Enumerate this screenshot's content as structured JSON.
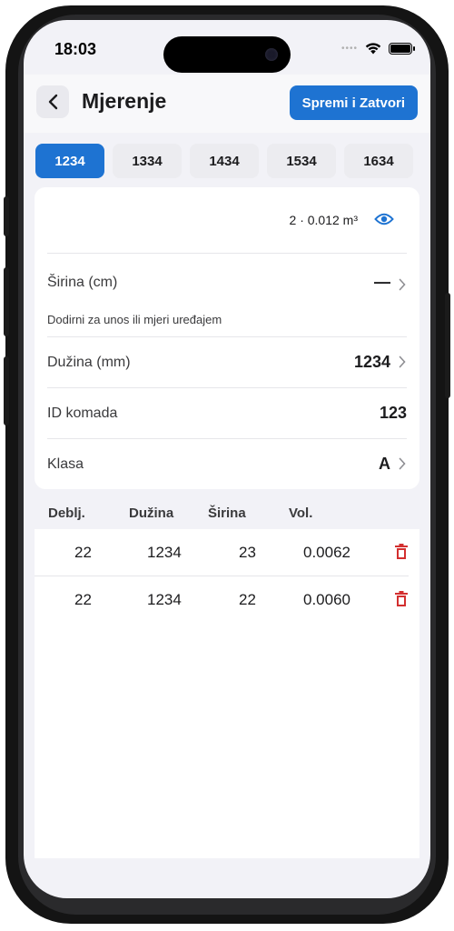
{
  "status_bar": {
    "time": "18:03",
    "dots": "••••"
  },
  "header": {
    "title": "Mjerenje",
    "save_label": "Spremi i Zatvori"
  },
  "tabs": [
    {
      "label": "1234",
      "active": true
    },
    {
      "label": "1334",
      "active": false
    },
    {
      "label": "1434",
      "active": false
    },
    {
      "label": "1534",
      "active": false
    },
    {
      "label": "1634",
      "active": false
    }
  ],
  "summary": {
    "volume_text": "2 · 0.012 m³"
  },
  "form": {
    "width": {
      "label": "Širina (cm)",
      "value": "—",
      "hint": "Dodirni za unos ili mjeri uređajem"
    },
    "length": {
      "label": "Dužina (mm)",
      "value": "1234"
    },
    "piece_id": {
      "label": "ID komada",
      "value": "123"
    },
    "grade": {
      "label": "Klasa",
      "value": "A"
    }
  },
  "table": {
    "headers": {
      "thickness": "Deblj.",
      "length": "Dužina",
      "width": "Širina",
      "volume": "Vol."
    },
    "rows": [
      {
        "thickness": "22",
        "length": "1234",
        "width": "23",
        "volume": "0.0062"
      },
      {
        "thickness": "22",
        "length": "1234",
        "width": "22",
        "volume": "0.0060"
      }
    ]
  },
  "colors": {
    "accent": "#1e73d2",
    "delete": "#d32f2f",
    "background": "#f2f2f7"
  },
  "icons": {
    "back": "chevron-left-icon",
    "eye": "eye-icon",
    "chevron": "chevron-right-icon",
    "delete": "trash-icon"
  }
}
